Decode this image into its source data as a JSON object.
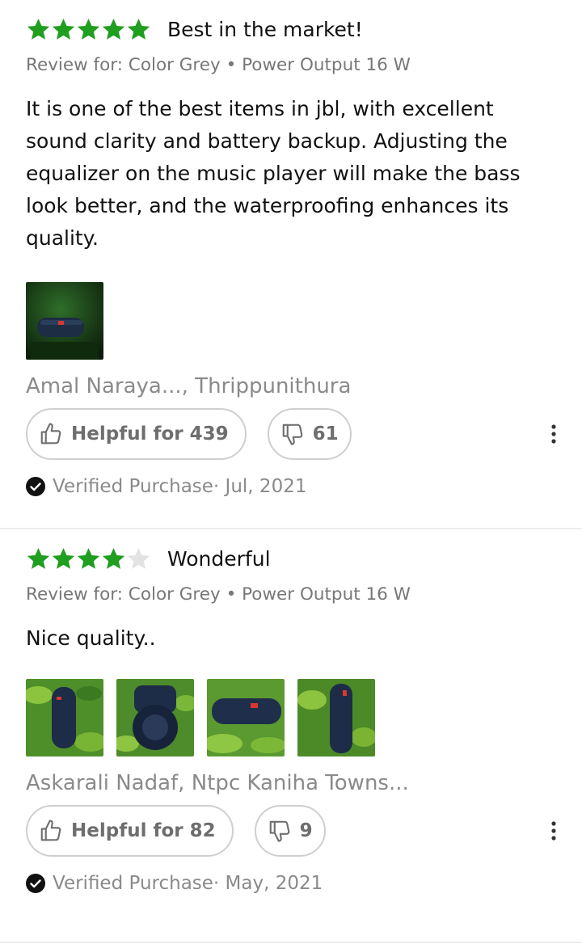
{
  "colors": {
    "star_filled": "#1f9e1f",
    "star_empty": "#e3e3e3",
    "muted_text": "#8a8a8a"
  },
  "reviews": [
    {
      "rating": 5,
      "title": "Best in the market!",
      "variant": "Review for: Color Grey • Power Output 16 W",
      "text": "It is one of the best items in jbl, with excellent sound clarity and battery backup. Adjusting the equalizer on the music player will make the bass look better, and the waterproofing enhances its quality.",
      "images": [
        "jbl-speaker-photo"
      ],
      "author": "Amal Naraya..., Thrippunithura",
      "helpful_label": "Helpful for 439",
      "dislike_count": "61",
      "verified": "Verified Purchase· Jul, 2021"
    },
    {
      "rating": 4,
      "title": "Wonderful",
      "variant": "Review for: Color Grey • Power Output 16 W",
      "text": "Nice quality..",
      "images": [
        "jbl-speaker-photo",
        "jbl-speaker-photo",
        "jbl-speaker-photo",
        "jbl-speaker-photo"
      ],
      "author": "Askarali Nadaf, Ntpc Kaniha Towns...",
      "helpful_label": "Helpful for 82",
      "dislike_count": "9",
      "verified": "Verified Purchase· May, 2021"
    }
  ],
  "icons": {
    "star": "star-icon",
    "helpful": "thumbs-up-icon",
    "dislike": "thumbs-down-icon",
    "more": "more-vertical-icon",
    "verified": "check-circle-icon"
  }
}
